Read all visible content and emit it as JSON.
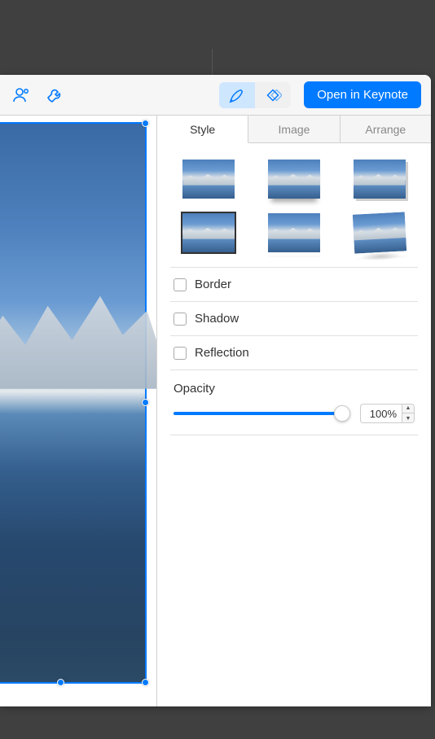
{
  "toolbar": {
    "open_button_label": "Open in Keynote"
  },
  "inspector": {
    "tabs": {
      "style": "Style",
      "image": "Image",
      "arrange": "Arrange"
    },
    "style": {
      "border_label": "Border",
      "shadow_label": "Shadow",
      "reflection_label": "Reflection",
      "opacity_label": "Opacity",
      "opacity_value": "100%"
    }
  }
}
